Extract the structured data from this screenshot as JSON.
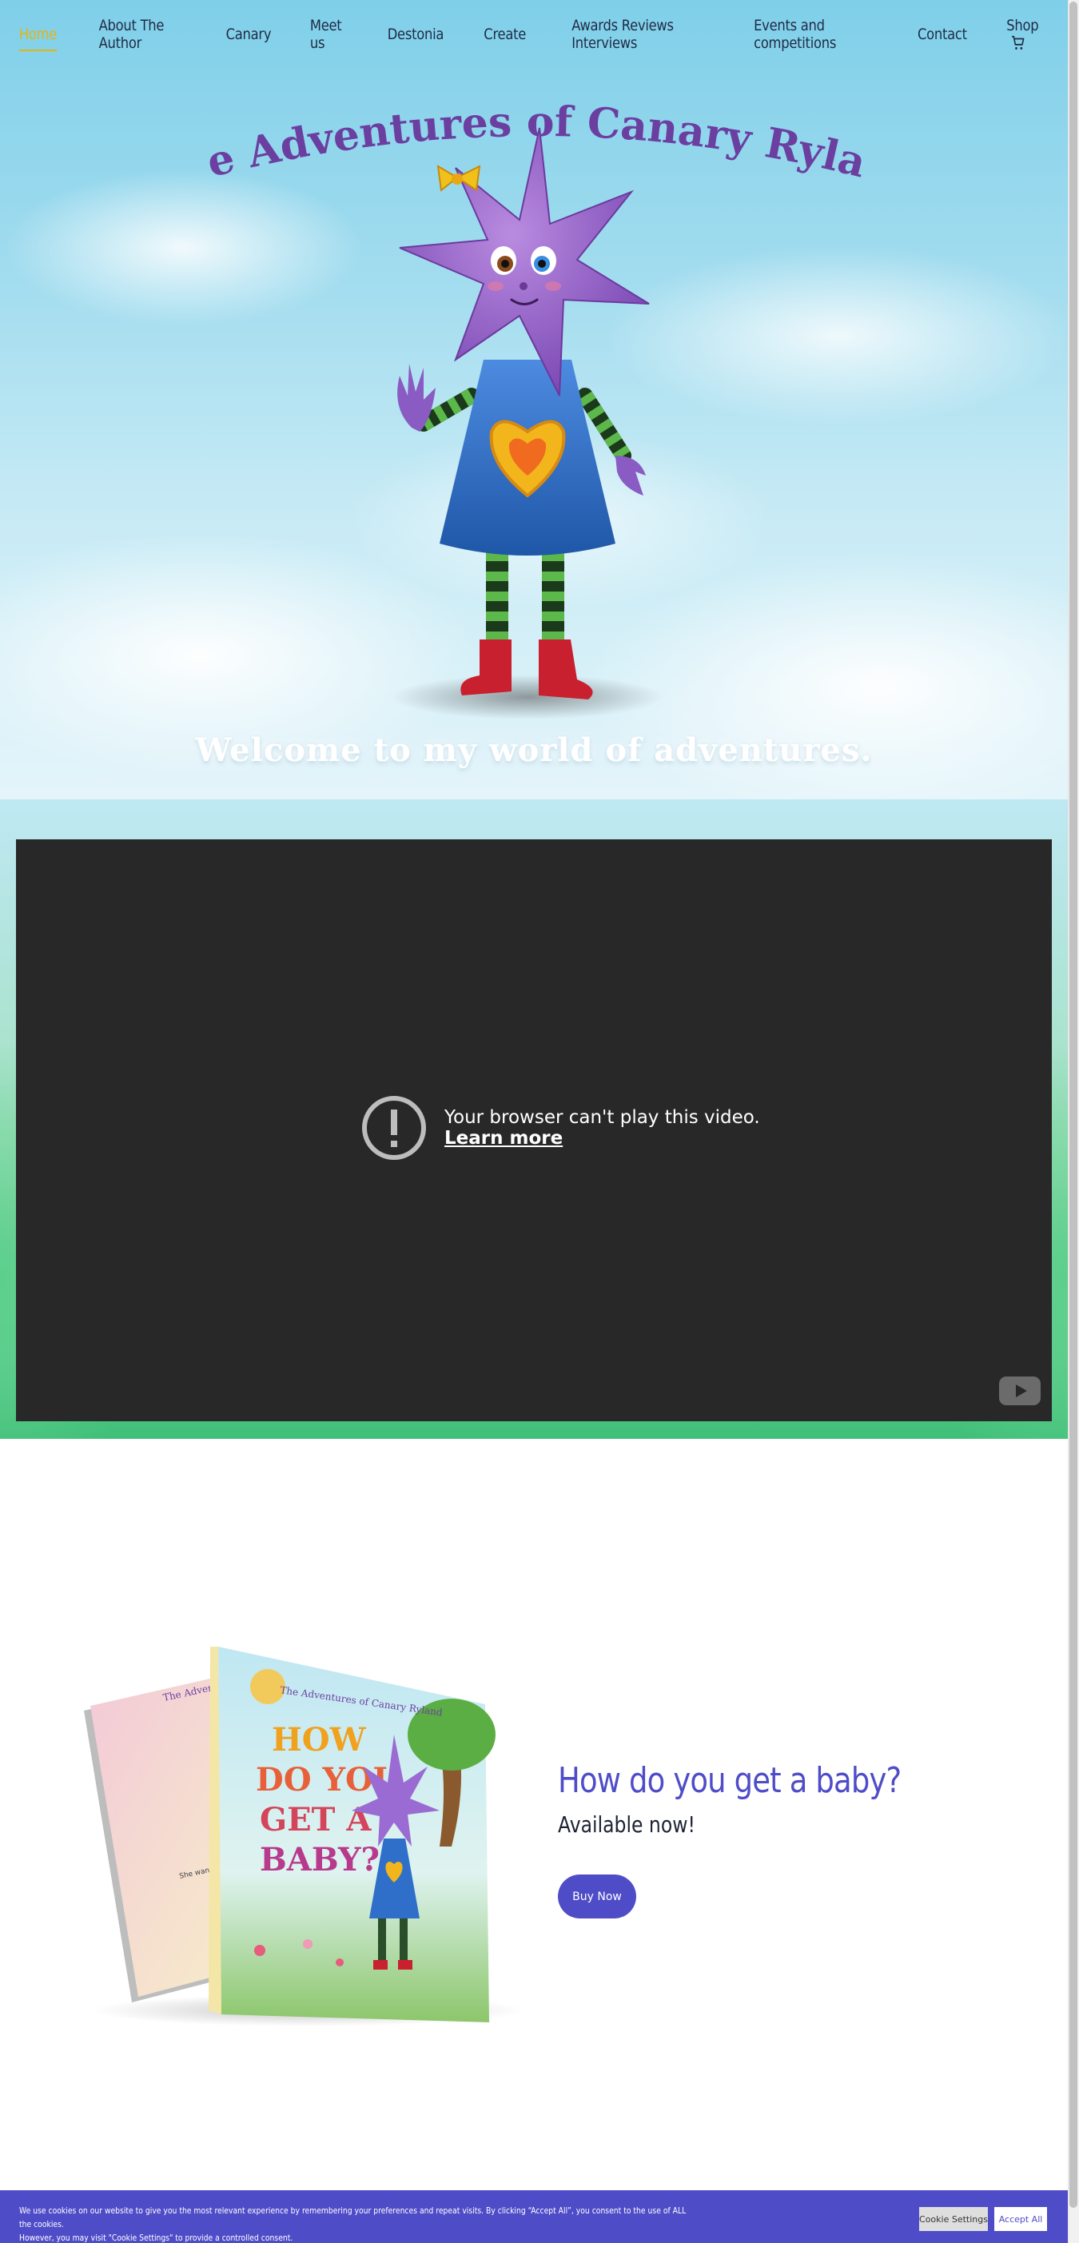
{
  "nav": {
    "items": [
      {
        "label": "Home",
        "active": true
      },
      {
        "label": "About The Author"
      },
      {
        "label": "Canary"
      },
      {
        "label": "Meet us"
      },
      {
        "label": "Destonia"
      },
      {
        "label": "Create"
      },
      {
        "label": "Awards Reviews Interviews"
      },
      {
        "label": "Events and competitions"
      },
      {
        "label": "Contact"
      },
      {
        "label": "Shop"
      }
    ],
    "cart_icon": "shopping-cart-icon"
  },
  "hero": {
    "title": "The Adventures of Canary Ryland",
    "welcome": "Welcome to my world of adventures."
  },
  "video": {
    "message": "Your browser can't play this video.",
    "link": "Learn more",
    "icons": [
      "alert-icon",
      "youtube-icon"
    ]
  },
  "book": {
    "cover_series": "The Adventures of Canary Ryland",
    "cover_title": [
      "HOW",
      "DO YOU",
      "GET A",
      "BABY?"
    ],
    "title": "How do you get a baby?",
    "subtitle": "Available now!",
    "button": "Buy Now"
  },
  "cookie": {
    "text_line1": "We use cookies on our website to give you the most relevant experience by remembering your preferences and repeat visits. By clicking “Accept All”, you consent to the use of ALL the cookies.",
    "text_line2": "However, you may visit \"Cookie Settings\" to provide a controlled consent.",
    "settings_button": "Cookie Settings",
    "accept_button": "Accept All"
  },
  "colors": {
    "accent": "#4f4cc8",
    "nav_active": "#e3b512",
    "nav_text": "#1f2a44",
    "title_purple": "#6b3fa0",
    "video_bg": "#282828"
  }
}
